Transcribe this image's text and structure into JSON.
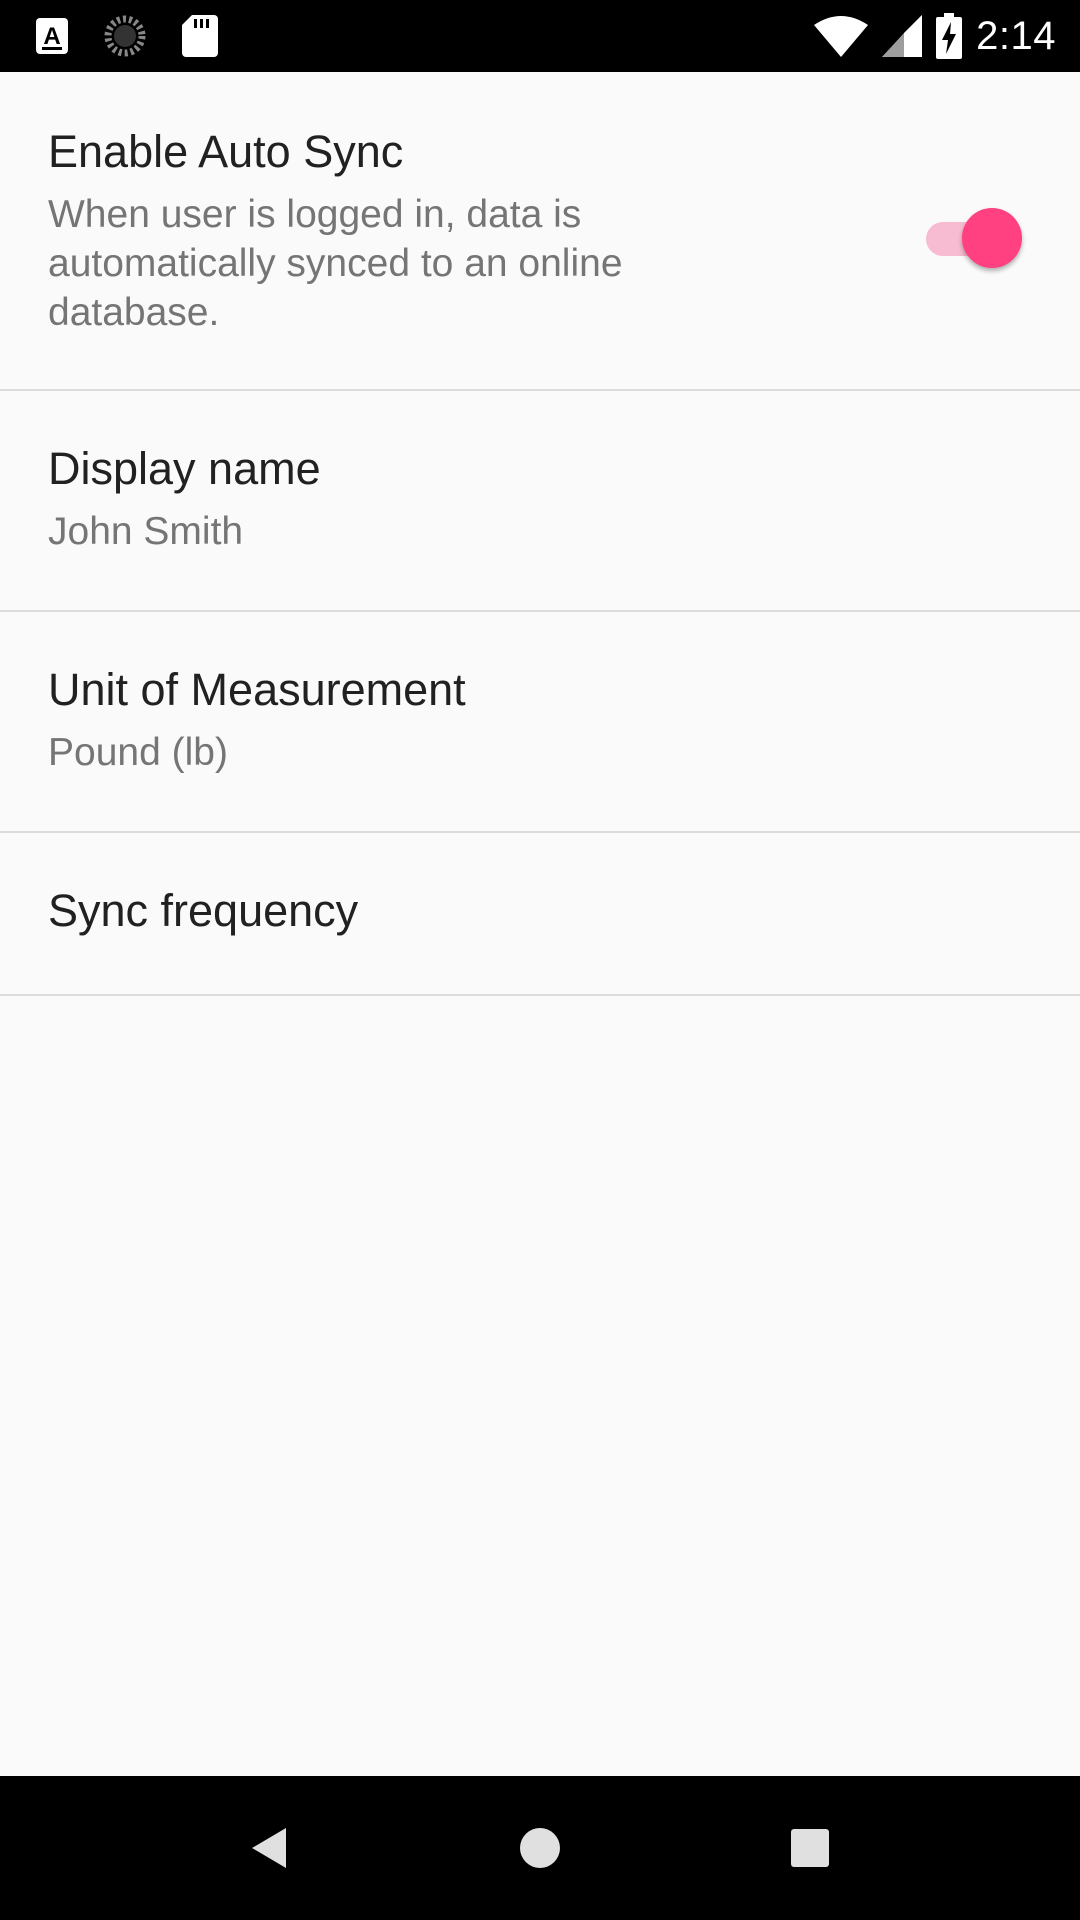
{
  "status_bar": {
    "time": "2:14",
    "left_icons": [
      "text-input-a-icon",
      "loading-spinner-icon",
      "sd-card-icon"
    ],
    "right_icons": [
      "wifi-icon",
      "cell-signal-icon",
      "battery-charging-icon"
    ]
  },
  "preferences": [
    {
      "title": "Enable Auto Sync",
      "summary": "When user is logged in, data is automatically synced to an online database.",
      "type": "switch",
      "checked": true
    },
    {
      "title": "Display name",
      "summary": "John Smith"
    },
    {
      "title": "Unit of Measurement",
      "summary": "Pound (lb)"
    },
    {
      "title": "Sync frequency"
    }
  ],
  "nav_bar": {
    "buttons": [
      "back-icon",
      "home-icon",
      "recents-icon"
    ]
  },
  "colors": {
    "accent": "#ff4081",
    "accent_track": "#f8bcd2",
    "background": "#fafafa",
    "divider": "#dcdcdc",
    "title_text": "#212121",
    "summary_text": "#757575"
  }
}
